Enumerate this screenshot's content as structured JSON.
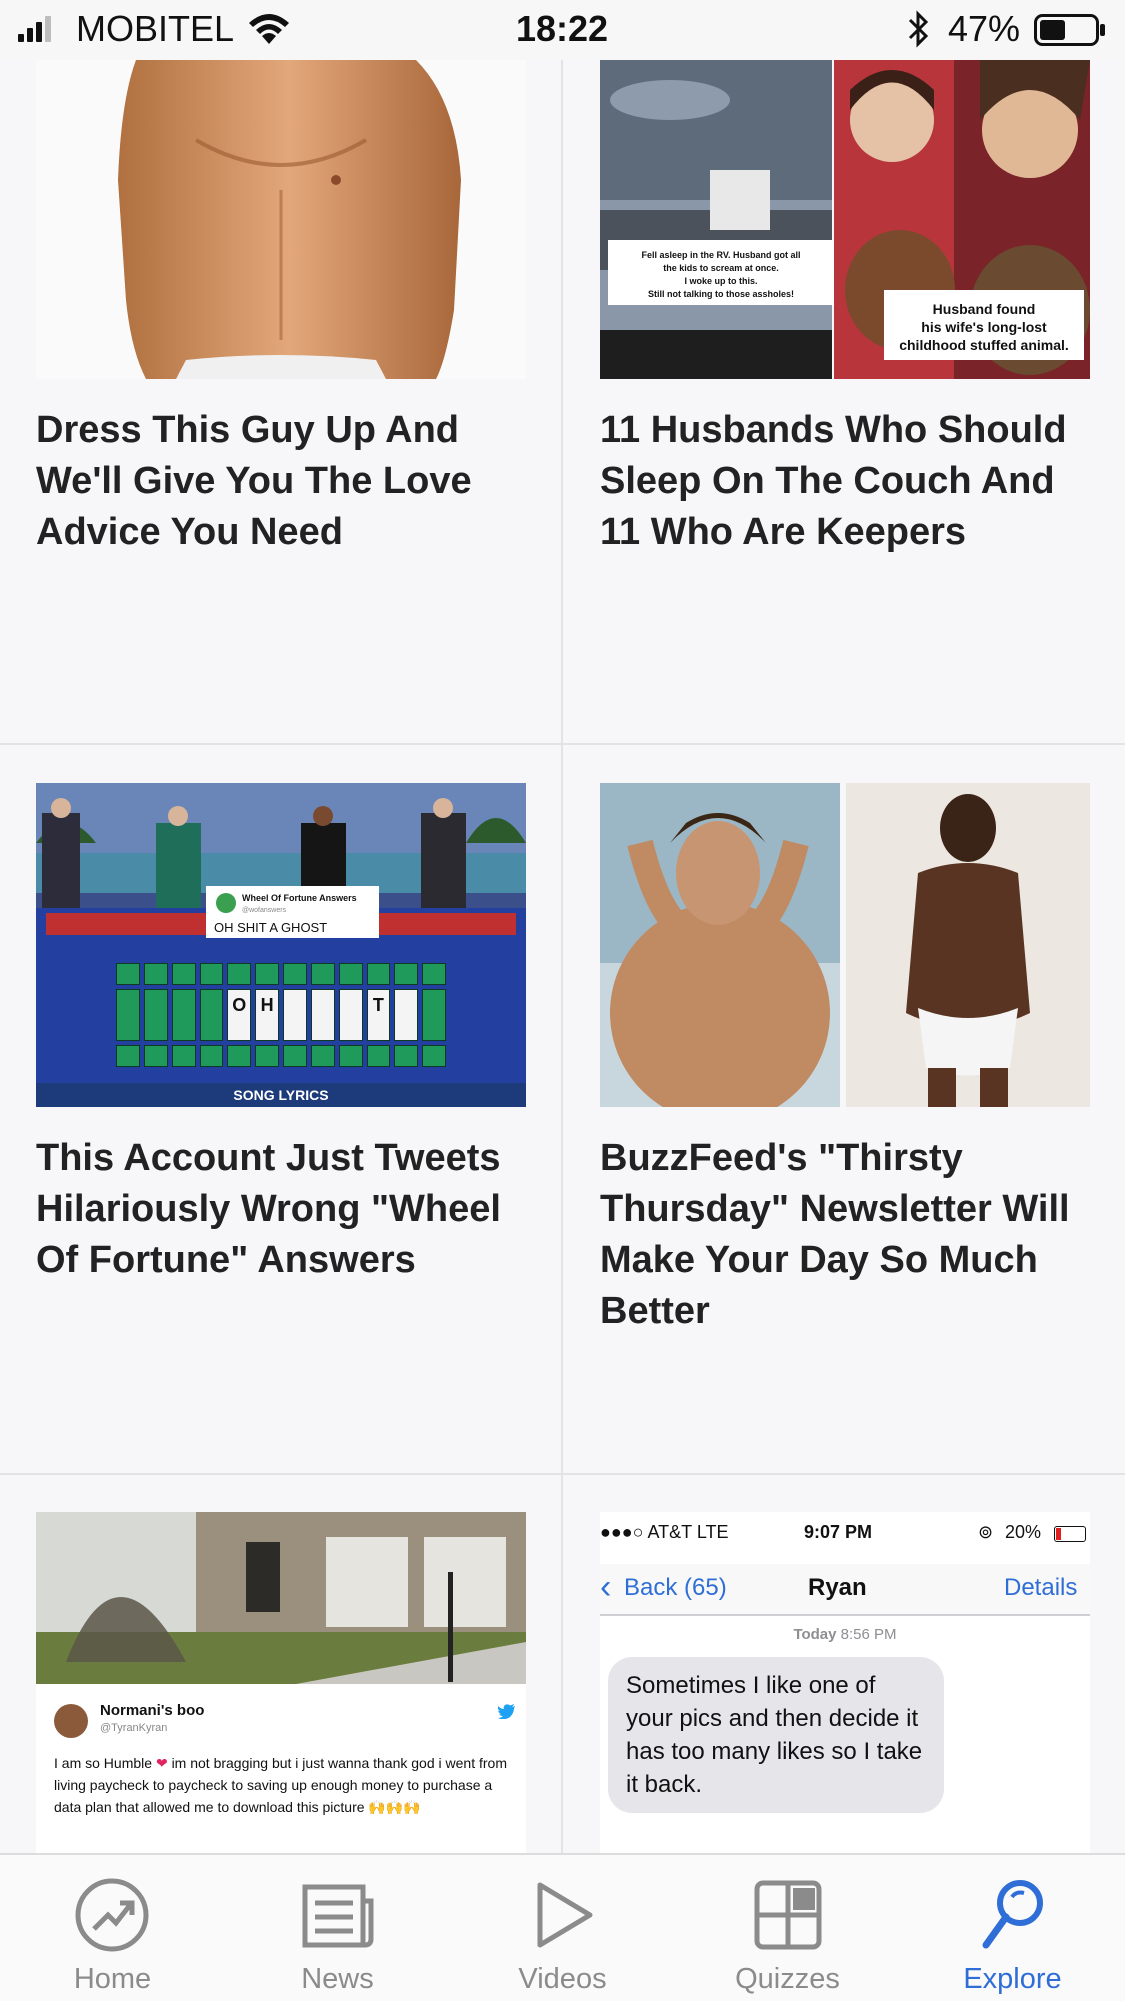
{
  "status_bar": {
    "carrier": "MOBITEL",
    "time": "18:22",
    "battery_percent": "47%",
    "battery_level": 0.47,
    "icons": [
      "signal-icon",
      "wifi-icon",
      "bluetooth-icon",
      "battery-icon"
    ]
  },
  "feed": {
    "cards": [
      {
        "title": "Dress This Guy Up And We'll Give You The Love Advice You Need",
        "image": "shirtless-man-torso"
      },
      {
        "title": "11 Husbands Who Should Sleep On The Couch And 11 Who Are Keepers",
        "image": "husbands-collage",
        "image_captions": {
          "left": "Fell asleep in the RV. Husband got all the kids to scream at once. I woke up to this. Still not talking to those assholes!",
          "right": "Husband found his wife's long-lost childhood stuffed animal."
        }
      },
      {
        "title": "This Account Just Tweets Hilariously Wrong \"Wheel Of Fortune\" Answers",
        "image": "wheel-of-fortune-board",
        "image_text": {
          "account": "Wheel Of Fortune Answers",
          "handle": "@wofanswers",
          "answer": "OH SHIT A GHOST",
          "board_letters": [
            "O",
            "H",
            "T"
          ],
          "category": "SONG LYRICS"
        }
      },
      {
        "title": "BuzzFeed's \"Thirsty Thursday\" Newsletter Will Make Your Day So Much Better",
        "image": "two-shirtless-men"
      },
      {
        "title": "",
        "image": "house-and-tweet",
        "tweet": {
          "name": "Normani's boo",
          "handle": "@TyranKyran",
          "text_before_heart": "I am so Humble",
          "text_after_heart": "im not bragging but i just wanna thank god i went from living paycheck to paycheck to saving up enough money to purchase a data plan that allowed me to download this picture",
          "emoji": "🙌🙌🙌"
        }
      },
      {
        "title": "",
        "image": "text-message-screenshot",
        "sms": {
          "carrier": "●●●○ AT&T  LTE",
          "time": "9:07 PM",
          "battery": "20%",
          "back": "Back (65)",
          "contact": "Ryan",
          "details": "Details",
          "timestamp_day": "Today",
          "timestamp_time": "8:56 PM",
          "message": "Sometimes I like one of your pics and then decide it has too many likes so I take it back."
        }
      }
    ]
  },
  "tab_bar": {
    "accent_color": "#2f6ed6",
    "inactive_color": "#8b8b8b",
    "tabs": [
      {
        "label": "Home",
        "icon": "trending-arrow-icon",
        "active": false
      },
      {
        "label": "News",
        "icon": "newspaper-icon",
        "active": false
      },
      {
        "label": "Videos",
        "icon": "play-icon",
        "active": false
      },
      {
        "label": "Quizzes",
        "icon": "quiz-grid-icon",
        "active": false
      },
      {
        "label": "Explore",
        "icon": "search-icon",
        "active": true
      }
    ]
  }
}
